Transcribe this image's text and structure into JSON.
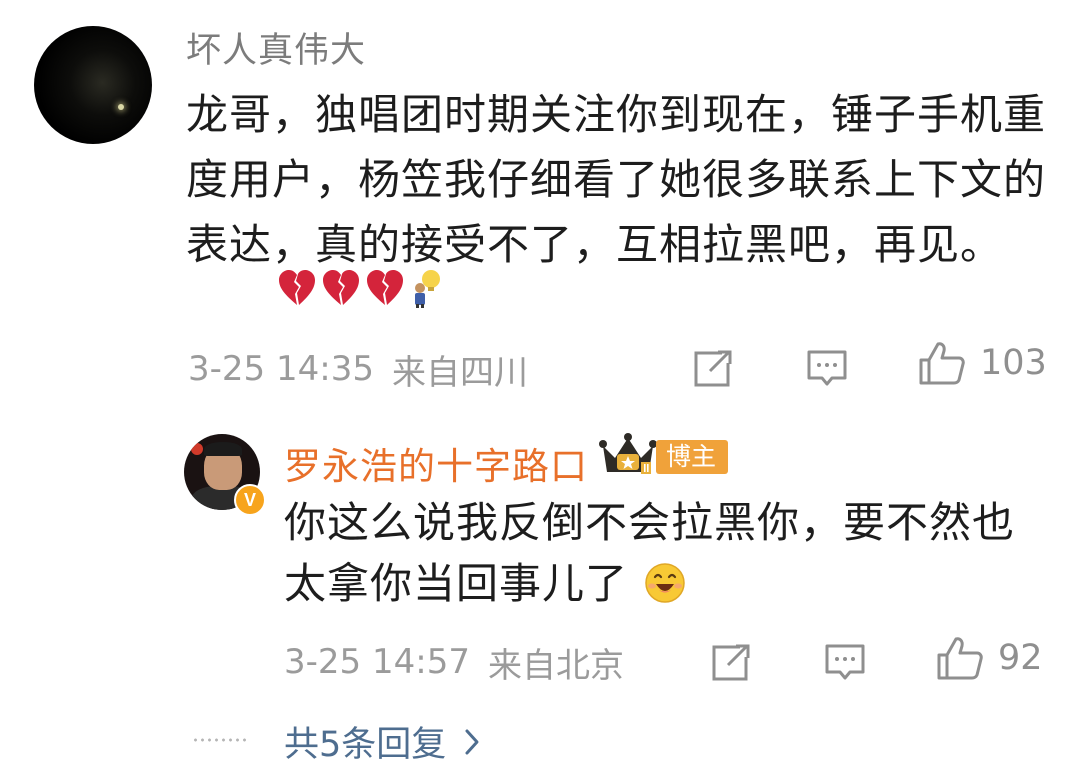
{
  "comment": {
    "username": "坏人真伟大",
    "text": "龙哥，独唱团时期关注你到现在，锤子手机重度用户，杨笠我仔细看了她很多联系上下文的表达，真的接受不了，互相拉黑吧，再见。",
    "emojis": [
      "broken-heart-icon",
      "broken-heart-icon",
      "broken-heart-icon",
      "lightbulb-person-icon"
    ],
    "time": "3-25 14:35",
    "location": "来自四川",
    "likes": "103"
  },
  "reply": {
    "username": "罗永浩的十字路口",
    "badge_label": "博主",
    "verified_label": "V",
    "text": "你这么说我反倒不会拉黑你，要不然也太拿你当回事儿了",
    "emoji": "grinning-face-icon",
    "time": "3-25 14:57",
    "location": "来自北京",
    "likes": "92"
  },
  "more_replies": {
    "label": "共5条回复"
  },
  "colors": {
    "username_gray": "#7c7c7c",
    "reply_username": "#e8702a",
    "blogger_badge": "#f0a23a",
    "link_blue": "#4e6d8f",
    "meta_gray": "#9b9b9b"
  }
}
